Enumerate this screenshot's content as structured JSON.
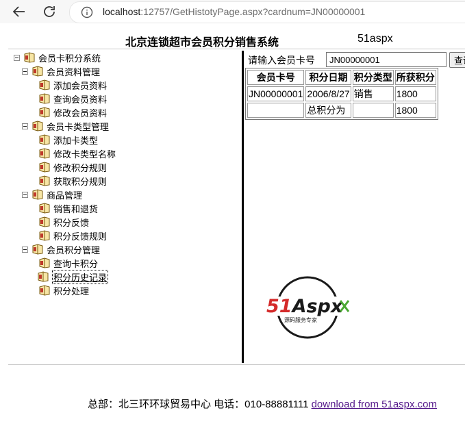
{
  "browser": {
    "url_host": "localhost",
    "url_rest": ":12757/GetHistotyPage.aspx?cardnum=JN00000001"
  },
  "header": {
    "title": "北京连锁超市会员积分销售系统",
    "brand": "51aspx"
  },
  "tree": {
    "root": "会员卡积分系统",
    "groups": [
      {
        "label": "会员资料管理",
        "items": [
          "添加会员资料",
          "查询会员资料",
          "修改会员资料"
        ]
      },
      {
        "label": "会员卡类型管理",
        "items": [
          "添加卡类型",
          "修改卡类型名称",
          "修改积分规则",
          "获取积分规则"
        ]
      },
      {
        "label": "商品管理",
        "items": [
          "销售和退货",
          "积分反馈",
          "积分反馈规则"
        ]
      },
      {
        "label": "会员积分管理",
        "items": [
          "查询卡积分",
          "积分历史记录",
          "积分处理"
        ]
      }
    ]
  },
  "search": {
    "label": "请输入会员卡号",
    "value": "JN00000001",
    "button": "查询"
  },
  "table": {
    "headers": [
      "会员卡号",
      "积分日期",
      "积分类型",
      "所获积分"
    ],
    "rows": [
      [
        "JN00000001",
        "2006/8/27",
        "销售",
        "1800"
      ],
      [
        "",
        "总积分为",
        "",
        "1800"
      ]
    ]
  },
  "logo": {
    "main": "51Aspx",
    "sub": "源码服务专家"
  },
  "footer": {
    "text": "总部：北三环环球贸易中心 电话：010-88881111",
    "link": "download from 51aspx.com"
  },
  "colors": {
    "logo_red": "#d42a2a",
    "logo_green": "#4aa832",
    "link": "#551a8b"
  }
}
